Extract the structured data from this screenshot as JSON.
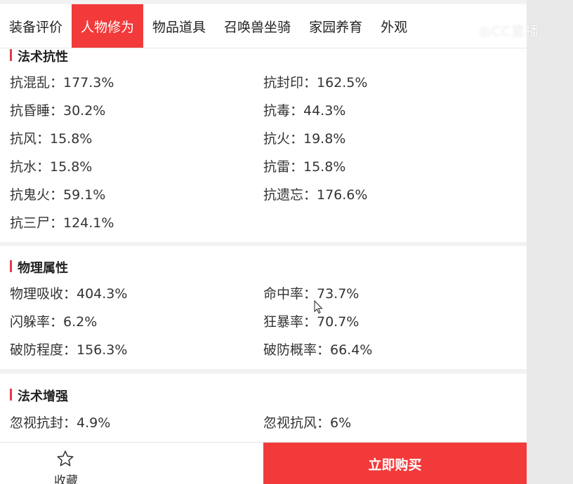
{
  "tabs": [
    {
      "label": "装备评价"
    },
    {
      "label": "人物修为",
      "active": true
    },
    {
      "label": "物品道具"
    },
    {
      "label": "召唤兽坐骑"
    },
    {
      "label": "家园养育"
    },
    {
      "label": "外观"
    }
  ],
  "watermark": "◎CC直播",
  "sections": {
    "magic_resist": {
      "title": "法术抗性",
      "items": [
        {
          "label": "抗混乱：177.3%"
        },
        {
          "label": "抗封印：162.5%"
        },
        {
          "label": "抗昏睡：30.2%"
        },
        {
          "label": "抗毒：44.3%"
        },
        {
          "label": "抗风：15.8%"
        },
        {
          "label": "抗火：19.8%"
        },
        {
          "label": "抗水：15.8%"
        },
        {
          "label": "抗雷：15.8%"
        },
        {
          "label": "抗鬼火：59.1%"
        },
        {
          "label": "抗遗忘：176.6%"
        },
        {
          "label": "抗三尸：124.1%"
        }
      ]
    },
    "physical": {
      "title": "物理属性",
      "items": [
        {
          "label": "物理吸收：404.3%"
        },
        {
          "label": "命中率：73.7%"
        },
        {
          "label": "闪躲率：6.2%"
        },
        {
          "label": "狂暴率：70.7%"
        },
        {
          "label": "破防程度：156.3%"
        },
        {
          "label": "破防概率：66.4%"
        }
      ]
    },
    "magic_boost": {
      "title": "法术增强",
      "items": [
        {
          "label": "忽视抗封：4.9%"
        },
        {
          "label": "忽视抗风：6%"
        }
      ]
    }
  },
  "bottom": {
    "favorite_label": "收藏",
    "buy_label": "立即购买"
  },
  "colors": {
    "accent": "#f23a3a",
    "title_bar": "#e23a4e"
  }
}
